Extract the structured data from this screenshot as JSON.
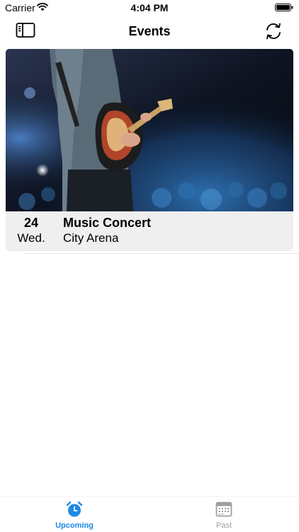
{
  "status_bar": {
    "carrier": "Carrier",
    "time": "4:04 PM"
  },
  "nav": {
    "title": "Events",
    "left_icon": "sidebar-icon",
    "right_icon": "refresh-icon"
  },
  "events": [
    {
      "day": "24",
      "weekday": "Wed.",
      "title": "Music Concert",
      "venue": "City Arena",
      "image": "guitarist-on-stage"
    }
  ],
  "tabs": [
    {
      "label": "Upcoming",
      "icon": "alarm-clock-icon",
      "selected": true
    },
    {
      "label": "Past",
      "icon": "calendar-icon",
      "selected": false
    }
  ],
  "colors": {
    "accent": "#1e88e5",
    "inactive": "#a0a0a0",
    "card_bg": "#efefef"
  }
}
